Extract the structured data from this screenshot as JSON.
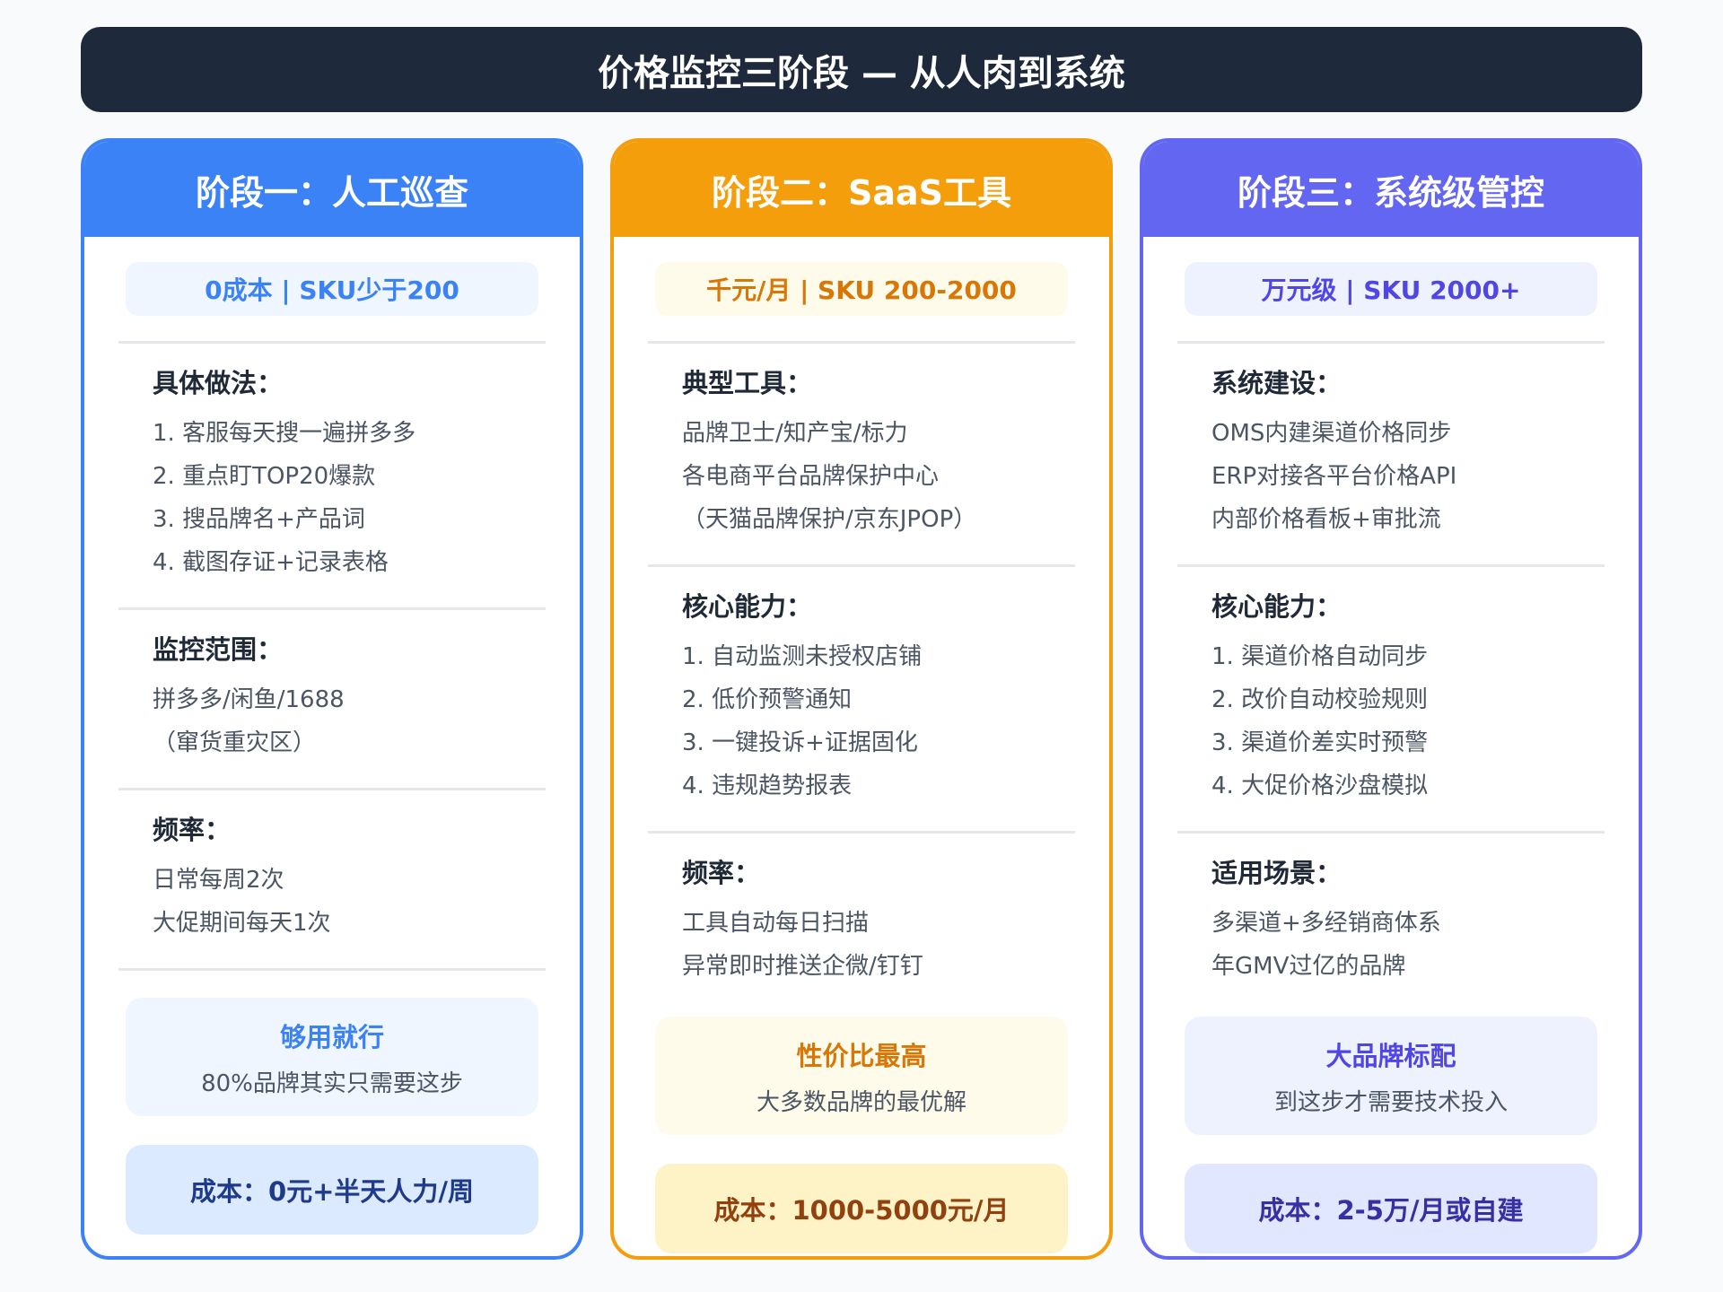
{
  "title": "价格监控三阶段 — 从人肉到系统",
  "colors": {
    "dark": "#1e293b",
    "blue": "#3b82f6",
    "orange": "#f59e0b",
    "purple": "#6366f1"
  },
  "stages": [
    {
      "header": "阶段一：人工巡查",
      "tag": "0成本 | SKU少于200",
      "sections": [
        {
          "title": "具体做法：",
          "items": [
            "1. 客服每天搜一遍拼多多",
            "2. 重点盯TOP20爆款",
            "3. 搜品牌名+产品词",
            "4. 截图存证+记录表格"
          ]
        },
        {
          "title": "监控范围：",
          "items": [
            "拼多多/闲鱼/1688",
            "（窜货重灾区）"
          ]
        },
        {
          "title": "频率：",
          "items": [
            "日常每周2次",
            "大促期间每天1次"
          ]
        }
      ],
      "note_title": "够用就行",
      "note_sub": "80%品牌其实只需要这步",
      "cost": "成本：0元+半天人力/周"
    },
    {
      "header": "阶段二：SaaS工具",
      "tag": "千元/月 | SKU 200-2000",
      "sections": [
        {
          "title": "典型工具：",
          "items": [
            "品牌卫士/知产宝/标力",
            "各电商平台品牌保护中心",
            "（天猫品牌保护/京东JPOP）"
          ]
        },
        {
          "title": "核心能力：",
          "items": [
            "1. 自动监测未授权店铺",
            "2. 低价预警通知",
            "3. 一键投诉+证据固化",
            "4. 违规趋势报表"
          ]
        },
        {
          "title": "频率：",
          "items": [
            "工具自动每日扫描",
            "异常即时推送企微/钉钉"
          ]
        }
      ],
      "note_title": "性价比最高",
      "note_sub": "大多数品牌的最优解",
      "cost": "成本：1000-5000元/月"
    },
    {
      "header": "阶段三：系统级管控",
      "tag": "万元级 | SKU 2000+",
      "sections": [
        {
          "title": "系统建设：",
          "items": [
            "OMS内建渠道价格同步",
            "ERP对接各平台价格API",
            "内部价格看板+审批流"
          ]
        },
        {
          "title": "核心能力：",
          "items": [
            "1. 渠道价格自动同步",
            "2. 改价自动校验规则",
            "3. 渠道价差实时预警",
            "4. 大促价格沙盘模拟"
          ]
        },
        {
          "title": "适用场景：",
          "items": [
            "多渠道+多经销商体系",
            "年GMV过亿的品牌"
          ]
        }
      ],
      "note_title": "大品牌标配",
      "note_sub": "到这步才需要技术投入",
      "cost": "成本：2-5万/月或自建"
    }
  ]
}
